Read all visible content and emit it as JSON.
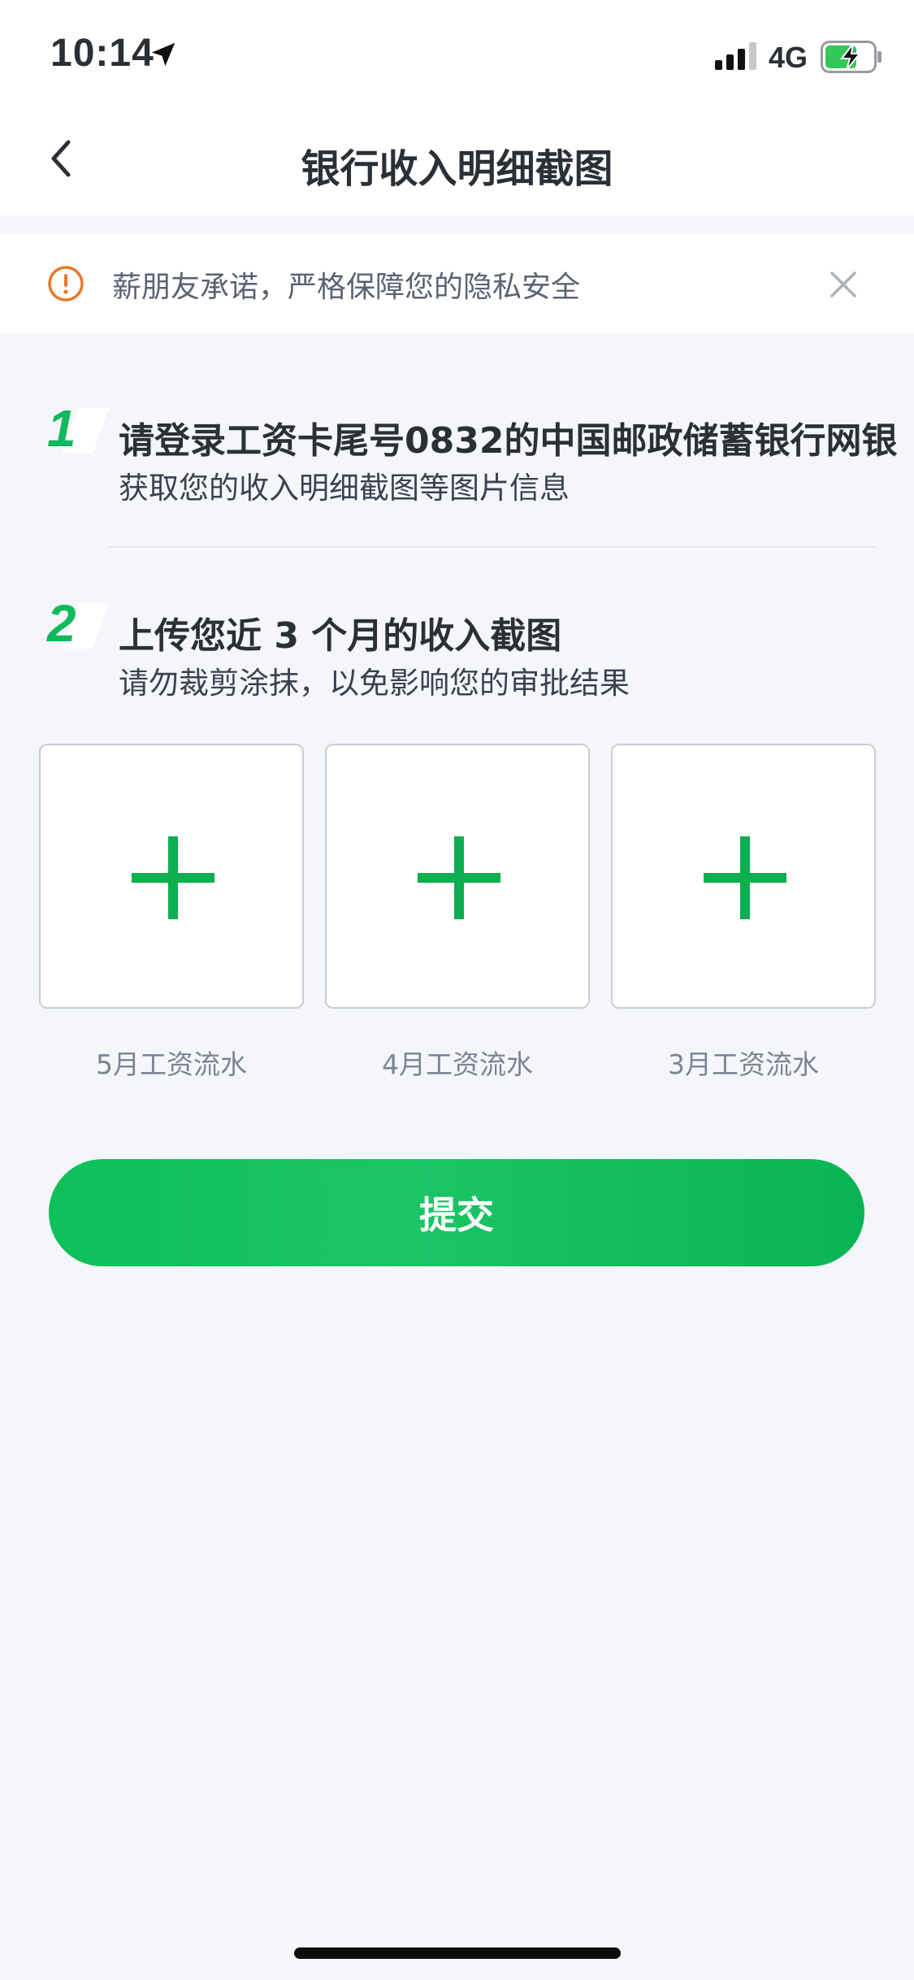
{
  "status_bar": {
    "time": "10:14",
    "network": "4G",
    "icons": [
      "location-arrow-icon",
      "signal-icon",
      "battery-charging-icon"
    ]
  },
  "nav": {
    "title": "银行收入明细截图",
    "back_icon": "chevron-left-icon"
  },
  "notice": {
    "text": "薪朋友承诺，严格保障您的隐私安全",
    "icon": "alert-circle-icon",
    "close_icon": "close-icon"
  },
  "steps": [
    {
      "number": "1",
      "title": "请登录工资卡尾号0832的中国邮政储蓄银行网银",
      "subtitle": "获取您的收入明细截图等图片信息"
    },
    {
      "number": "2",
      "title": "上传您近 3 个月的收入截图",
      "subtitle": "请勿裁剪涂抹，以免影响您的审批结果"
    }
  ],
  "uploads": [
    {
      "label": "5月工资流水",
      "icon": "plus-icon"
    },
    {
      "label": "4月工资流水",
      "icon": "plus-icon"
    },
    {
      "label": "3月工资流水",
      "icon": "plus-icon"
    }
  ],
  "submit_label": "提交",
  "colors": {
    "accent": "#12b85c",
    "warning": "#e8782a",
    "background": "#f5f6fa"
  }
}
